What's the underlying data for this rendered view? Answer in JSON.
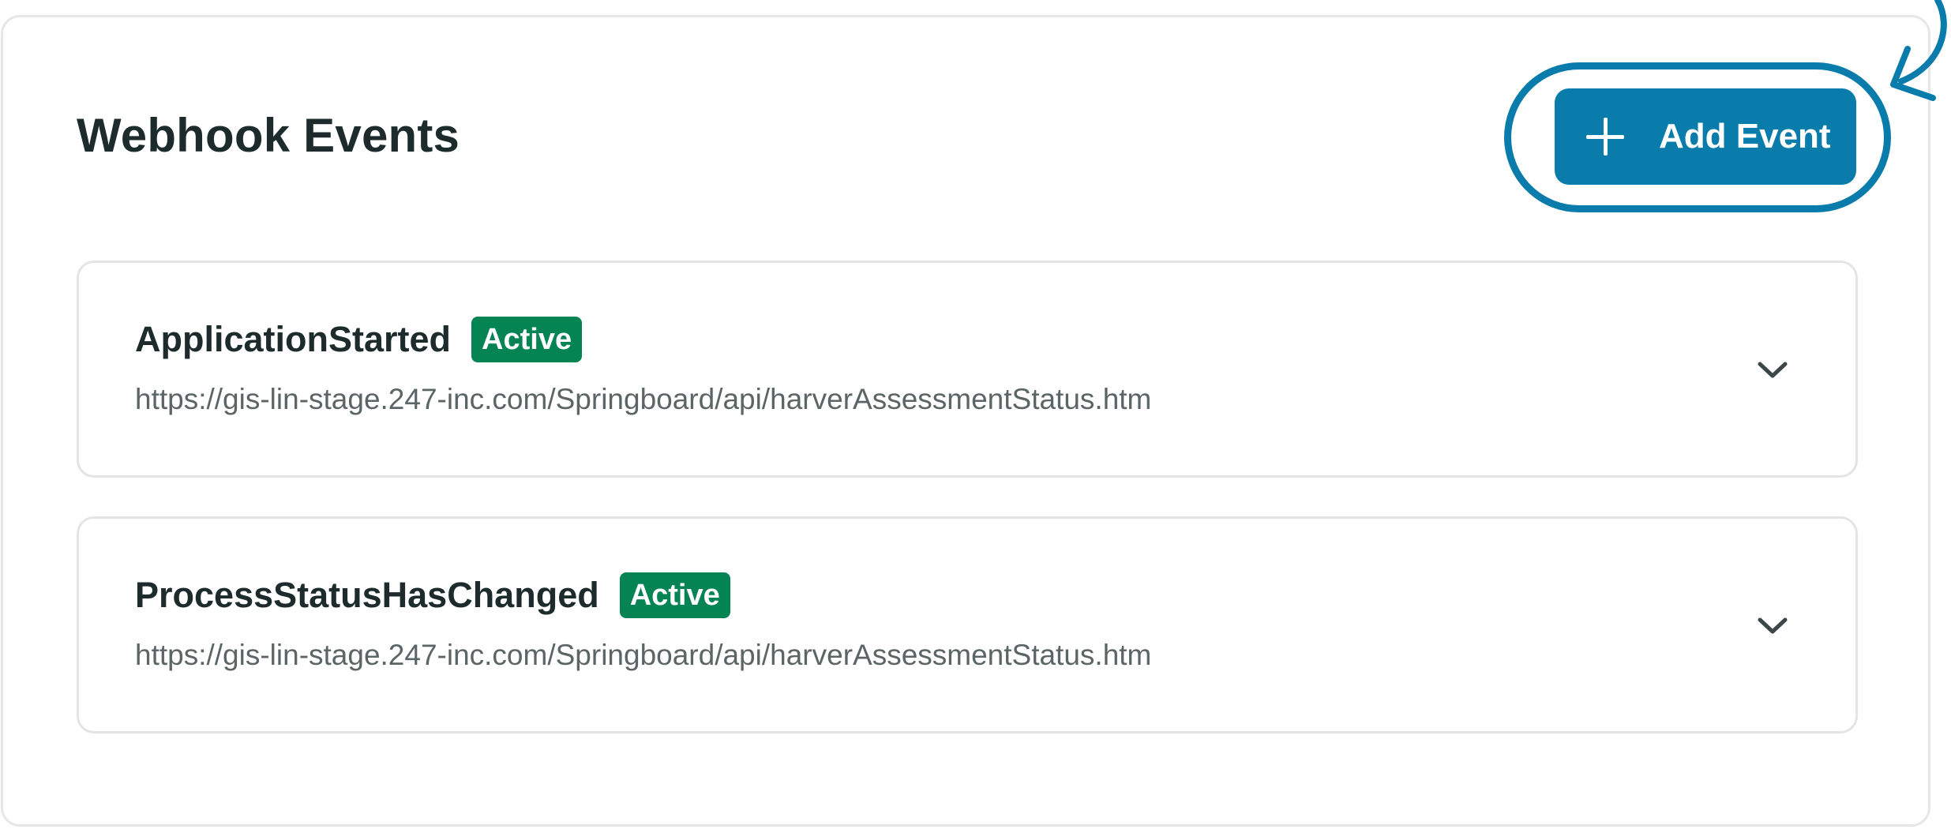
{
  "page_title": "Webhook Events",
  "add_button": {
    "label": "Add Event",
    "icon": "plus-icon"
  },
  "annotation": {
    "color": "#0a7cab"
  },
  "events": [
    {
      "name": "ApplicationStarted",
      "status": "Active",
      "url": "https://gis-lin-stage.247-inc.com/Springboard/api/harverAssessmentStatus.htm",
      "icon": "chevron-down-icon"
    },
    {
      "name": "ProcessStatusHasChanged",
      "status": "Active",
      "url": "https://gis-lin-stage.247-inc.com/Springboard/api/harverAssessmentStatus.htm",
      "icon": "chevron-down-icon"
    }
  ],
  "colors": {
    "accent": "#0a7cab",
    "status_active": "#058453",
    "title_text": "#1d2b2c",
    "url_text": "#5b6566"
  }
}
